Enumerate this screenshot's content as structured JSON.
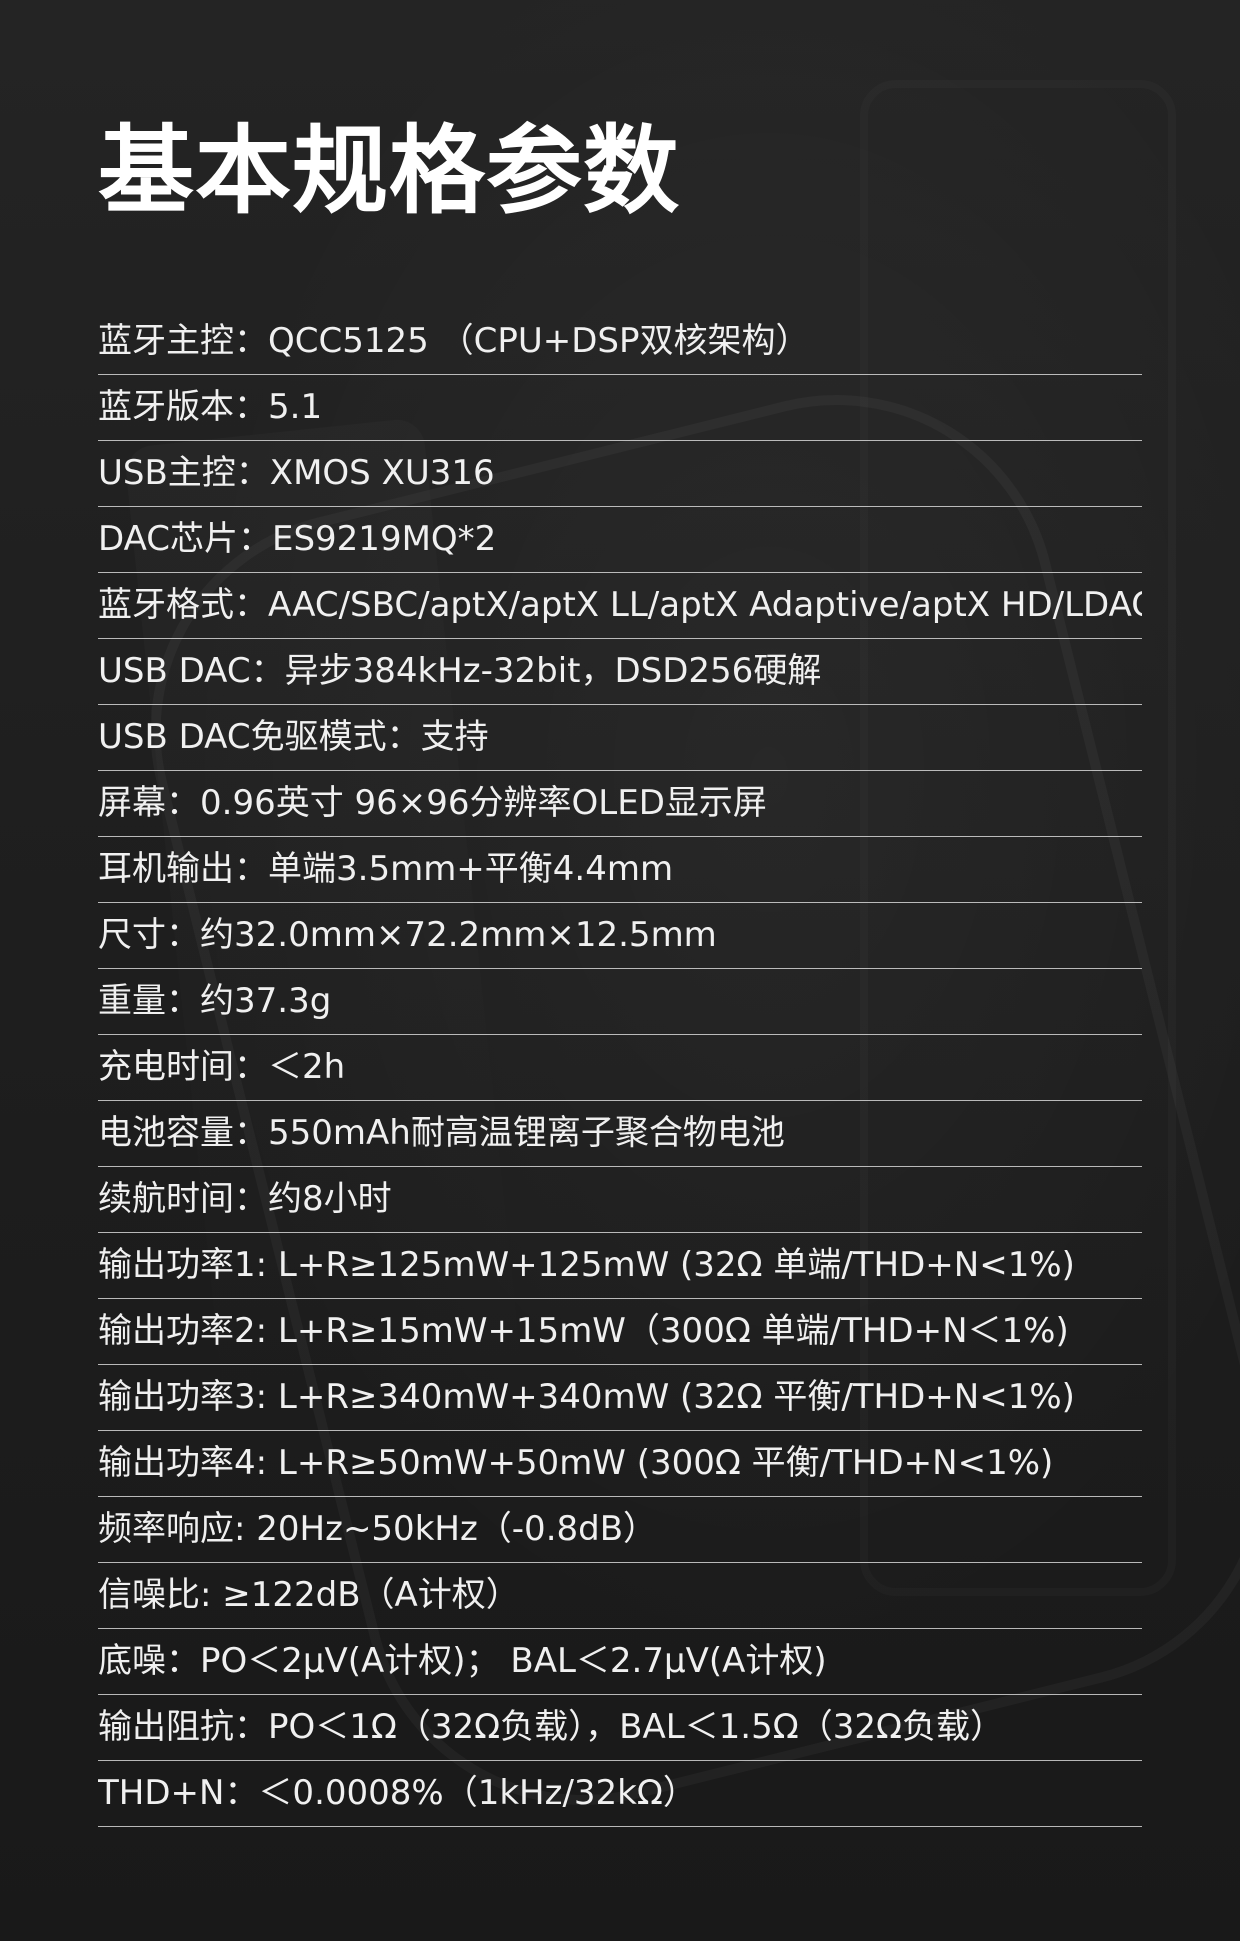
{
  "page": {
    "title": "基本规格参数"
  },
  "specs": [
    "蓝牙主控：QCC5125 （CPU+DSP双核架构）",
    "蓝牙版本：5.1",
    "USB主控：XMOS XU316",
    "DAC芯片：ES9219MQ*2",
    "蓝牙格式：AAC/SBC/aptX/aptX LL/aptX Adaptive/aptX HD/LDAC",
    "USB DAC：异步384kHz-32bit，DSD256硬解",
    "USB DAC免驱模式：支持",
    "屏幕：0.96英寸 96×96分辨率OLED显示屏",
    "耳机输出：单端3.5mm+平衡4.4mm",
    "尺寸：约32.0mm×72.2mm×12.5mm",
    "重量：约37.3g",
    "充电时间：＜2h",
    "电池容量：550mAh耐高温锂离子聚合物电池",
    "续航时间：约8小时",
    "输出功率1: L+R≥125mW+125mW (32Ω 单端/THD+N<1%)",
    "输出功率2: L+R≥15mW+15mW（300Ω 单端/THD+N＜1%)",
    "输出功率3: L+R≥340mW+340mW (32Ω 平衡/THD+N<1%)",
    "输出功率4: L+R≥50mW+50mW (300Ω 平衡/THD+N<1%)",
    "频率响应: 20Hz~50kHz（-0.8dB）",
    "信噪比: ≥122dB（A计权）",
    "底噪：PO＜2μV(A计权)； BAL＜2.7μV(A计权)",
    "输出阻抗：PO＜1Ω（32Ω负载），BAL＜1.5Ω（32Ω负载）",
    "THD+N：＜0.0008%（1kHz/32kΩ）"
  ]
}
